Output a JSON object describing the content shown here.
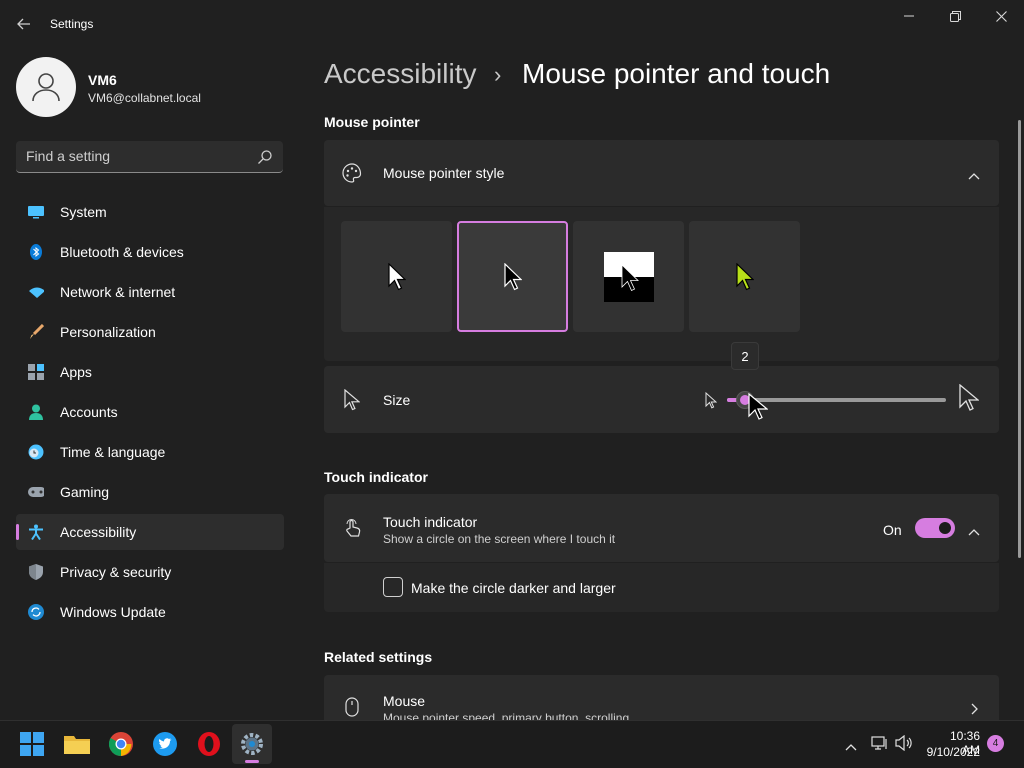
{
  "window": {
    "app_title": "Settings",
    "controls": [
      "minimize",
      "maximize",
      "close"
    ]
  },
  "user": {
    "name": "VM6",
    "email": "VM6@collabnet.local"
  },
  "search": {
    "placeholder": "Find a setting"
  },
  "sidebar": {
    "items": [
      {
        "label": "System",
        "icon": "monitor-icon",
        "active": false
      },
      {
        "label": "Bluetooth & devices",
        "icon": "bluetooth-icon",
        "active": false
      },
      {
        "label": "Network & internet",
        "icon": "wifi-icon",
        "active": false
      },
      {
        "label": "Personalization",
        "icon": "brush-icon",
        "active": false
      },
      {
        "label": "Apps",
        "icon": "apps-icon",
        "active": false
      },
      {
        "label": "Accounts",
        "icon": "person-icon",
        "active": false
      },
      {
        "label": "Time & language",
        "icon": "clock-globe-icon",
        "active": false
      },
      {
        "label": "Gaming",
        "icon": "gamepad-icon",
        "active": false
      },
      {
        "label": "Accessibility",
        "icon": "accessibility-icon",
        "active": true
      },
      {
        "label": "Privacy & security",
        "icon": "shield-icon",
        "active": false
      },
      {
        "label": "Windows Update",
        "icon": "update-icon",
        "active": false
      }
    ]
  },
  "breadcrumb": {
    "parent": "Accessibility",
    "separator": "›",
    "current": "Mouse pointer and touch"
  },
  "mouse_pointer": {
    "section_title": "Mouse pointer",
    "style_label": "Mouse pointer style",
    "styles": [
      {
        "name": "white",
        "selected": false
      },
      {
        "name": "black",
        "selected": true
      },
      {
        "name": "inverted",
        "selected": false
      },
      {
        "name": "custom",
        "selected": false,
        "color": "#b8e019"
      }
    ],
    "size_label": "Size",
    "size_value": "2",
    "size_min": 1,
    "size_max": 15
  },
  "touch_indicator": {
    "section_title": "Touch indicator",
    "label": "Touch indicator",
    "description": "Show a circle on the screen where I touch it",
    "state_text": "On",
    "enabled": true,
    "darker_label": "Make the circle darker and larger",
    "darker_checked": false
  },
  "related": {
    "section_title": "Related settings",
    "mouse_label": "Mouse",
    "mouse_description": "Mouse pointer speed, primary button, scrolling"
  },
  "taskbar": {
    "apps": [
      "start",
      "file-explorer",
      "chrome",
      "twitter",
      "opera",
      "settings"
    ],
    "time": "10:36 AM",
    "date": "9/10/2022",
    "notification_count": "4"
  },
  "colors": {
    "accent": "#d67de0",
    "background": "#202020",
    "card": "#2b2b2b"
  }
}
